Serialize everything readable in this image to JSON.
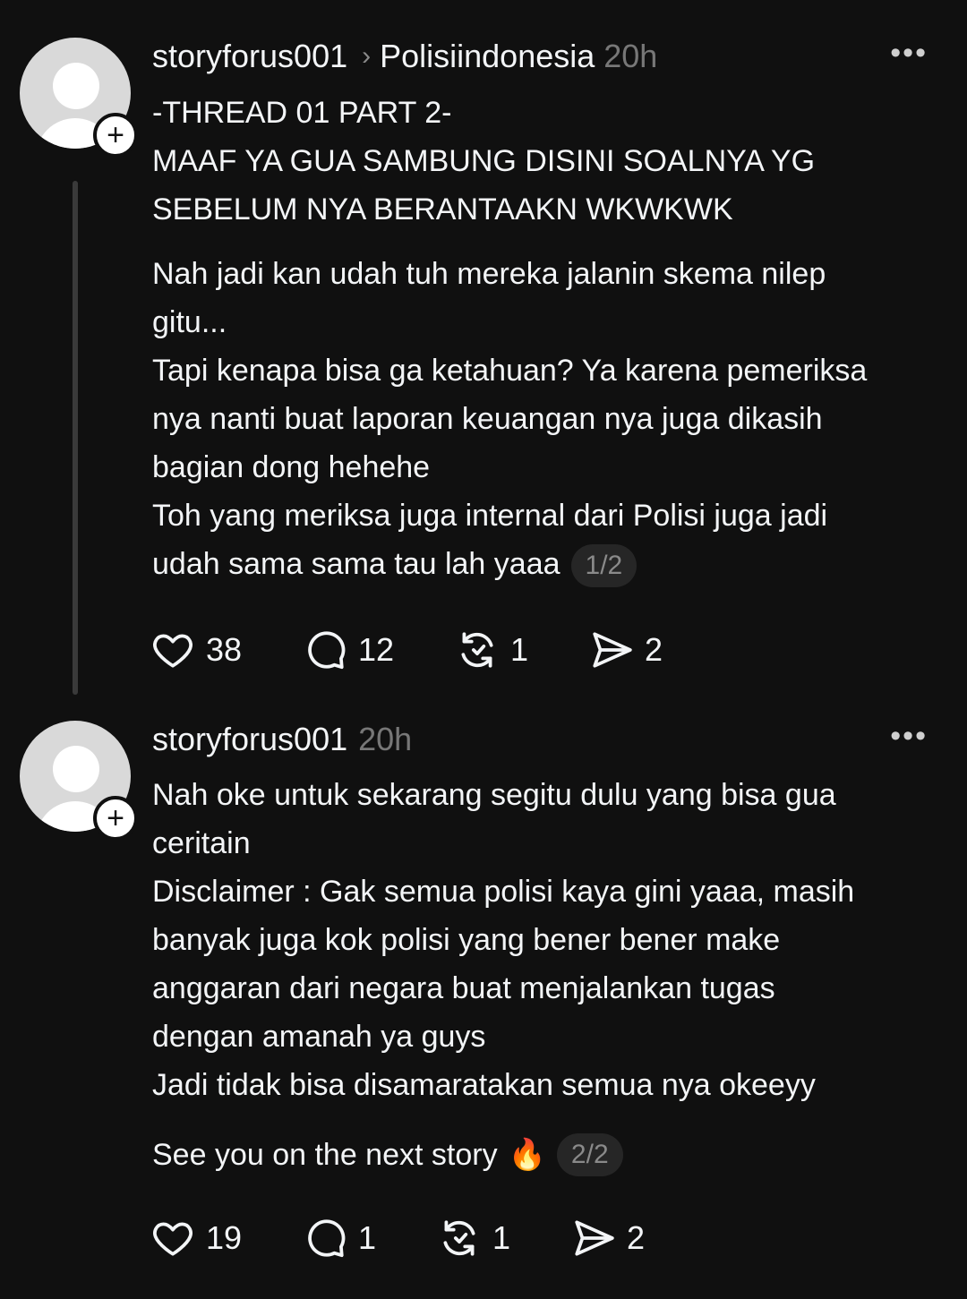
{
  "posts": [
    {
      "username": "storyforus001",
      "community": "Polisiindonesia",
      "time": "20h",
      "more": "•••",
      "title_lines": [
        "-THREAD 01 PART 2-",
        "MAAF YA GUA SAMBUNG DISINI SOALNYA YG",
        "SEBELUM NYA BERANTAAKN WKWKWK"
      ],
      "body_lines": [
        "Nah jadi kan udah tuh mereka jalanin skema nilep",
        "gitu...",
        "Tapi kenapa bisa ga ketahuan? Ya karena pemeriksa",
        "nya nanti buat laporan keuangan nya juga dikasih",
        "bagian dong hehehe",
        "Toh yang meriksa juga internal dari Polisi juga jadi",
        "udah sama sama tau lah yaaa"
      ],
      "page_indicator": "1/2",
      "likes": "38",
      "replies": "12",
      "reposts": "1",
      "shares": "2"
    },
    {
      "username": "storyforus001",
      "time": "20h",
      "more": "•••",
      "body_lines": [
        "Nah oke untuk sekarang segitu dulu yang bisa gua",
        "ceritain",
        "Disclaimer : Gak semua polisi kaya gini yaaa, masih",
        "banyak juga kok polisi yang bener bener make",
        "anggaran dari negara buat menjalankan tugas",
        "dengan amanah ya guys",
        "Jadi tidak bisa disamaratakan semua nya okeeyy"
      ],
      "last_line": "See you on the next story",
      "emoji": "🔥",
      "page_indicator": "2/2",
      "likes": "19",
      "replies": "1",
      "reposts": "1",
      "shares": "2"
    }
  ],
  "icons": {
    "like": "heart-icon",
    "reply": "comment-icon",
    "repost": "repost-icon",
    "share": "share-icon",
    "more": "more-options-icon",
    "follow": "plus-icon"
  },
  "colors": {
    "background": "#101010",
    "text": "#f3f5f7",
    "muted": "#777777",
    "avatar": "#d9d9d9"
  }
}
